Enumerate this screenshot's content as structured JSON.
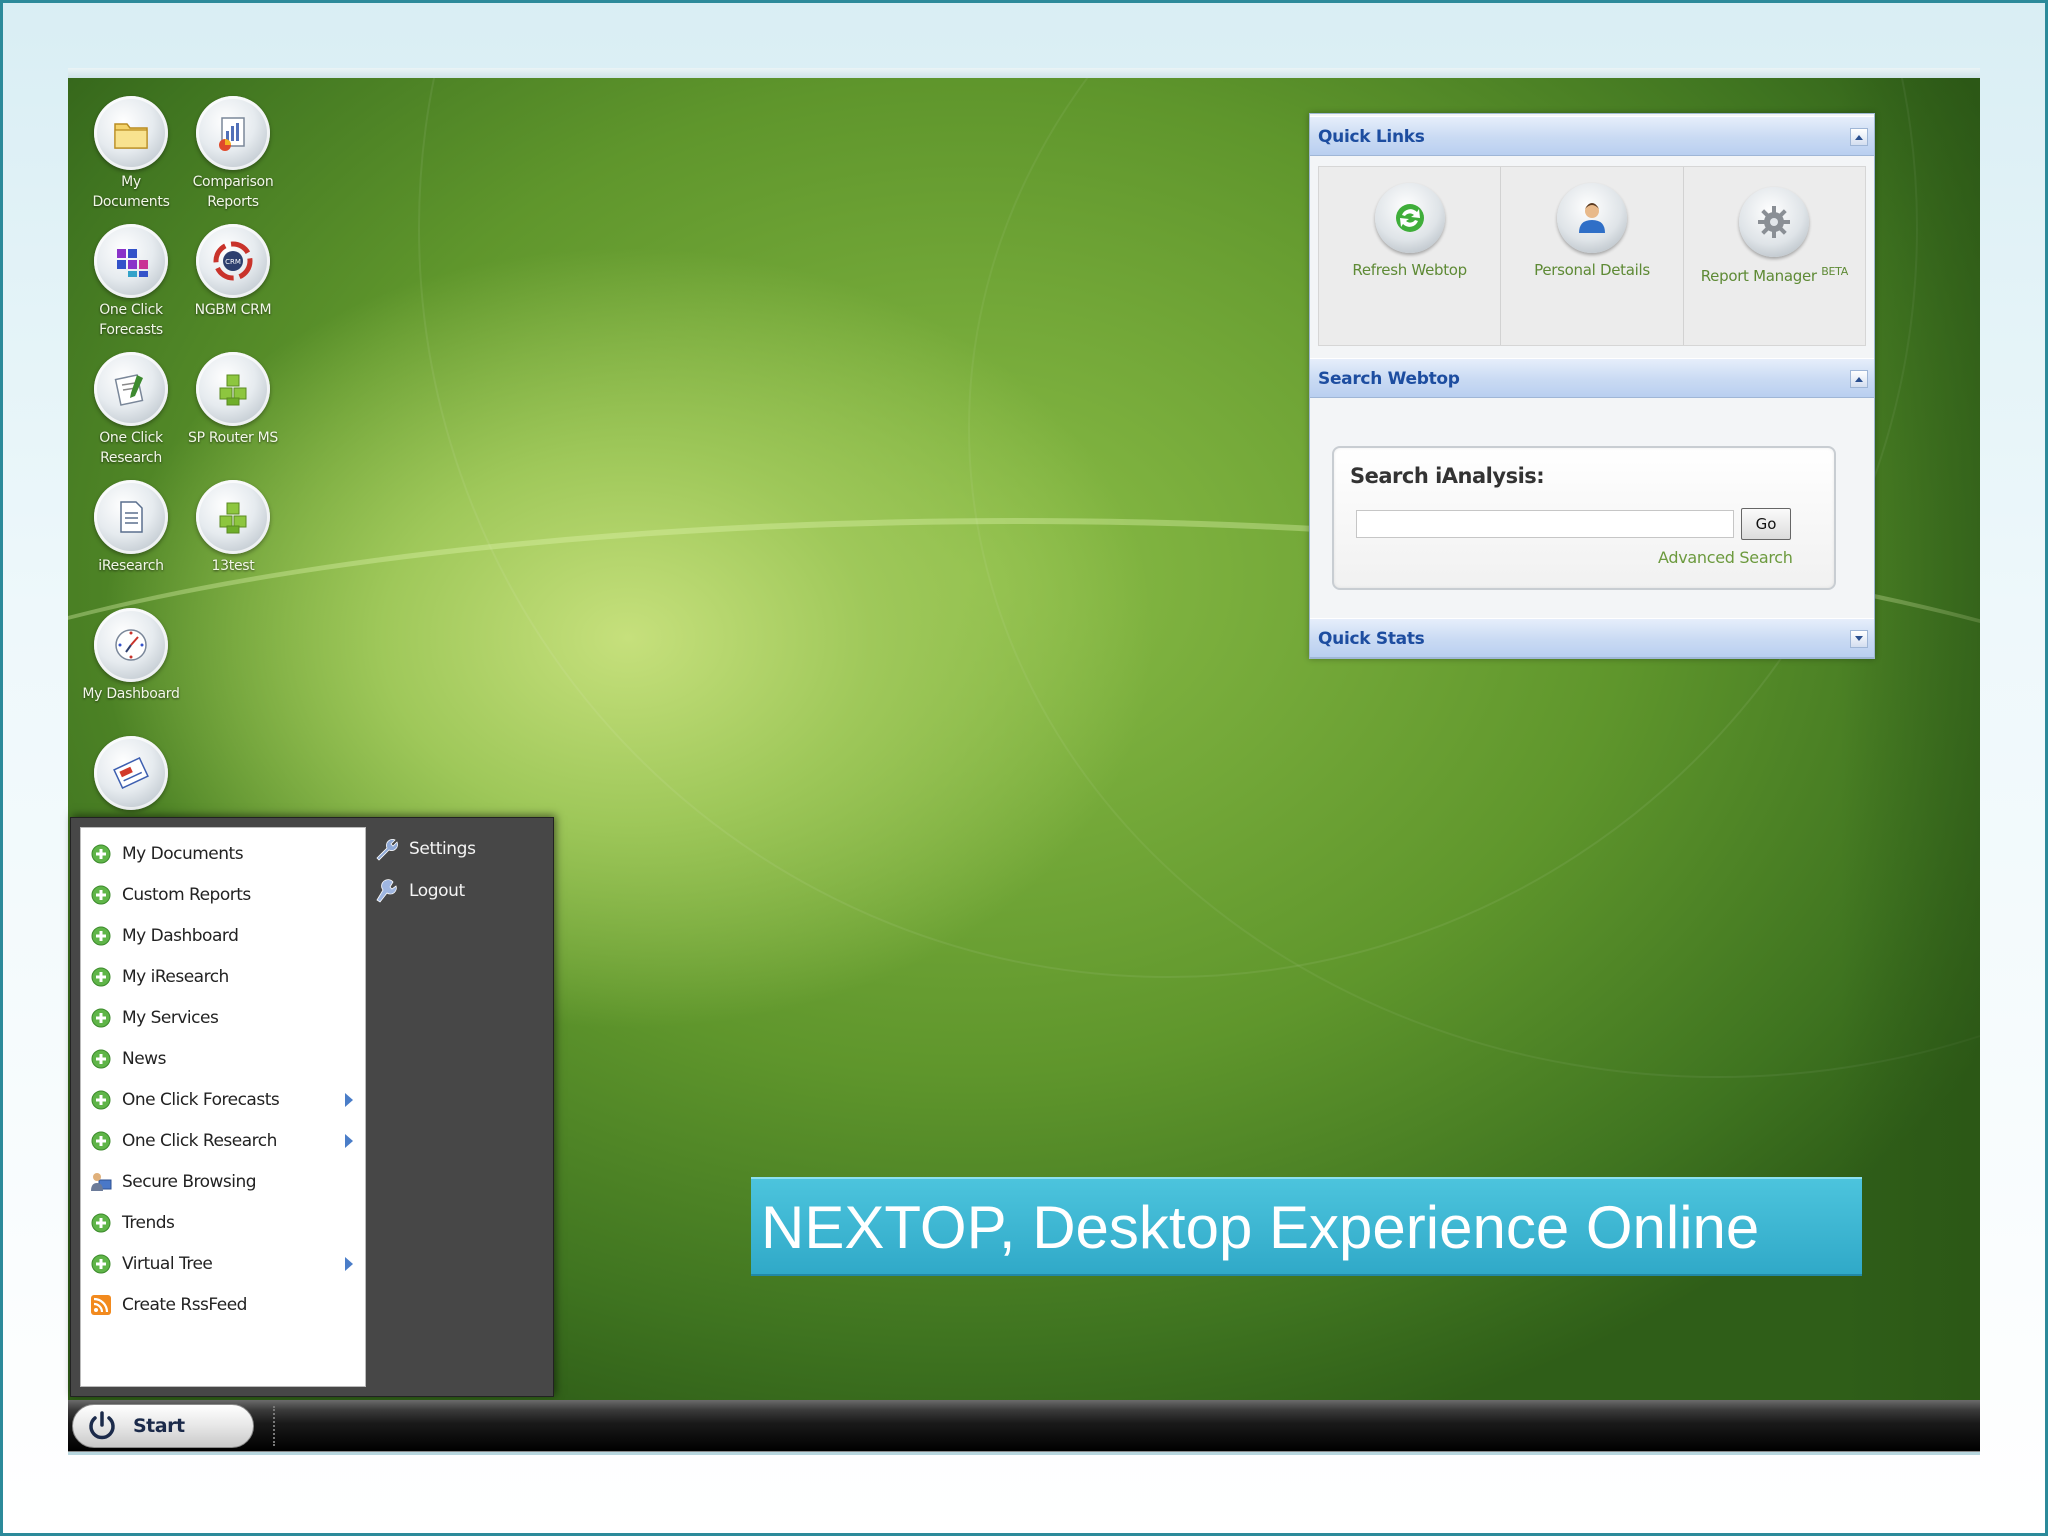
{
  "desktop": {
    "icons": [
      {
        "label": "My Documents",
        "icon": "folder-icon"
      },
      {
        "label": "Comparison Reports",
        "icon": "report-chart-icon"
      },
      {
        "label": "One Click Forecasts",
        "icon": "blocks-icon"
      },
      {
        "label": "NGBM CRM",
        "icon": "crm-icon"
      },
      {
        "label": "One Click Research",
        "icon": "document-pencil-icon"
      },
      {
        "label": "SP Router MS",
        "icon": "green-cubes-icon"
      },
      {
        "label": "iResearch",
        "icon": "document-icon"
      },
      {
        "label": "13test",
        "icon": "green-cubes-icon"
      },
      {
        "label": "My Dashboard",
        "icon": "compass-icon"
      },
      {
        "label": "",
        "icon": "newspaper-icon"
      }
    ]
  },
  "widgets": {
    "quick_links": {
      "title": "Quick Links",
      "items": [
        {
          "label": "Refresh Webtop",
          "icon": "refresh-icon"
        },
        {
          "label": "Personal Details",
          "icon": "user-icon"
        },
        {
          "label": "Report Manager",
          "badge": "BETA",
          "icon": "gear-icon"
        }
      ]
    },
    "search_webtop": {
      "title": "Search Webtop",
      "search_title": "Search iAnalysis:",
      "input_value": "",
      "go_label": "Go",
      "advanced_link": "Advanced Search"
    },
    "quick_stats": {
      "title": "Quick Stats"
    }
  },
  "start_menu": {
    "items": [
      {
        "label": "My Documents",
        "icon": "green-plus-icon",
        "submenu": false
      },
      {
        "label": "Custom Reports",
        "icon": "green-plus-icon",
        "submenu": false
      },
      {
        "label": "My Dashboard",
        "icon": "green-plus-icon",
        "submenu": false
      },
      {
        "label": "My iResearch",
        "icon": "green-plus-icon",
        "submenu": false
      },
      {
        "label": "My Services",
        "icon": "green-plus-icon",
        "submenu": false
      },
      {
        "label": "News",
        "icon": "green-plus-icon",
        "submenu": false
      },
      {
        "label": "One Click Forecasts",
        "icon": "green-plus-icon",
        "submenu": true
      },
      {
        "label": "One Click Research",
        "icon": "green-plus-icon",
        "submenu": true
      },
      {
        "label": "Secure Browsing",
        "icon": "user-computer-icon",
        "submenu": false
      },
      {
        "label": "Trends",
        "icon": "green-plus-icon",
        "submenu": false
      },
      {
        "label": "Virtual Tree",
        "icon": "green-plus-icon",
        "submenu": true
      },
      {
        "label": "Create RssFeed",
        "icon": "rss-icon",
        "submenu": false
      }
    ],
    "right_items": [
      {
        "label": "Settings",
        "icon": "wrench-icon"
      },
      {
        "label": "Logout",
        "icon": "logout-icon"
      }
    ]
  },
  "taskbar": {
    "start_label": "Start"
  },
  "banner": {
    "text": "NEXTOP, Desktop Experience Online"
  },
  "colors": {
    "accent_blue": "#1d4da0",
    "link_green": "#6c9a3e",
    "banner_cyan": "#3ab5d2",
    "menu_dark": "#474747"
  }
}
